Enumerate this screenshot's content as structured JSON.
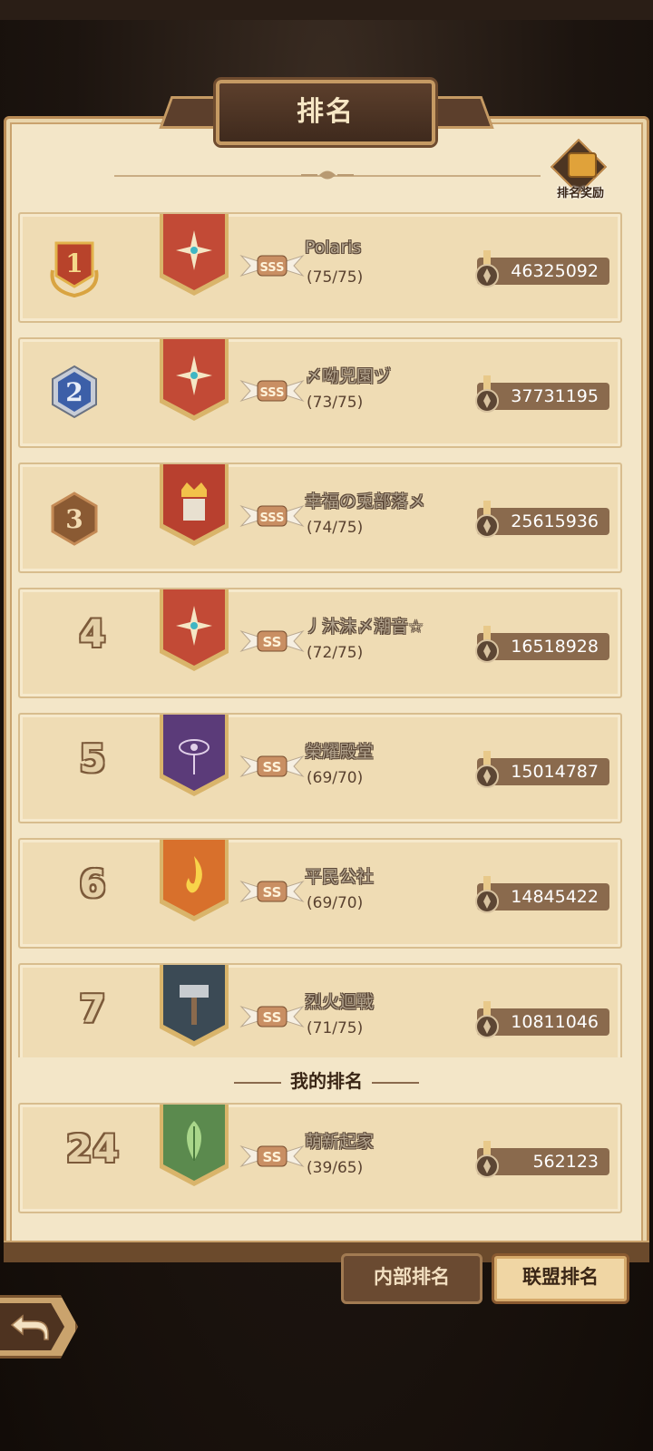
{
  "header": {
    "title": "排名"
  },
  "reward_button": {
    "label": "排名奖励"
  },
  "rankings": [
    {
      "rank": "1",
      "name": "Polaris",
      "members": "(75/75)",
      "grade": "SSS",
      "score": "46325092",
      "banner": "red-star"
    },
    {
      "rank": "2",
      "name": "〆呦兕園ヅ",
      "members": "(73/75)",
      "grade": "SSS",
      "score": "37731195",
      "banner": "red-star"
    },
    {
      "rank": "3",
      "name": "幸福の兎部落メ",
      "members": "(74/75)",
      "grade": "SSS",
      "score": "25615936",
      "banner": "red-king"
    },
    {
      "rank": "4",
      "name": "丿沐沫〆潮音☆",
      "members": "(72/75)",
      "grade": "SS",
      "score": "16518928",
      "banner": "red-star"
    },
    {
      "rank": "5",
      "name": "榮耀殿堂",
      "members": "(69/70)",
      "grade": "SS",
      "score": "15014787",
      "banner": "purple-eye"
    },
    {
      "rank": "6",
      "name": "平民公社",
      "members": "(69/70)",
      "grade": "SS",
      "score": "14845422",
      "banner": "orange-flame"
    },
    {
      "rank": "7",
      "name": "烈火迴戰",
      "members": "(71/75)",
      "grade": "SS",
      "score": "10811046",
      "banner": "steel-hammer"
    }
  ],
  "my_rank": {
    "title": "我的排名",
    "entry": {
      "rank": "24",
      "name": "萌新起家",
      "members": "(39/65)",
      "grade": "SS",
      "score": "562123",
      "banner": "green-leaf"
    }
  },
  "tabs": {
    "internal": "内部排名",
    "alliance": "联盟排名",
    "active": "alliance"
  },
  "colors": {
    "panel": "#f3e6c8",
    "frame": "#b98b55",
    "score_bg": "#8a6a4d",
    "title_plate": "#4d3522"
  }
}
